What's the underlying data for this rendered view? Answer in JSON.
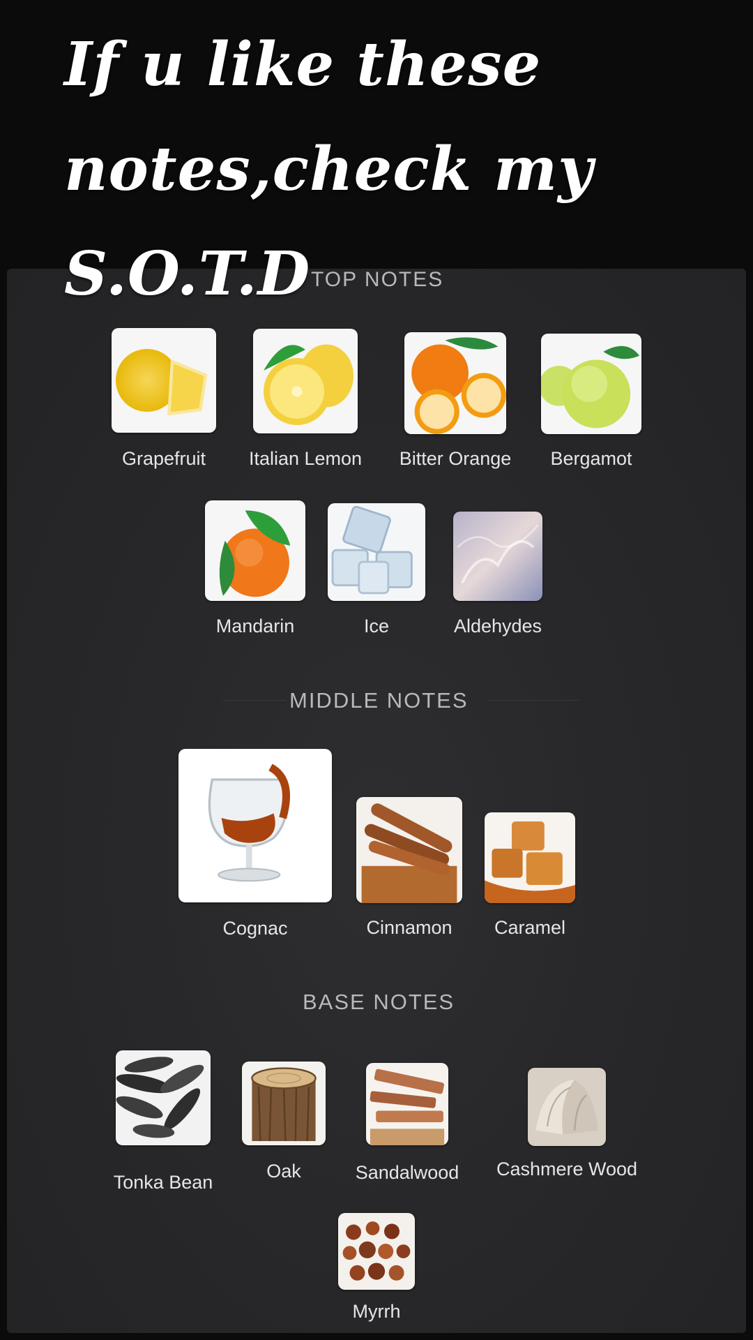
{
  "caption": {
    "line1": "If u like these",
    "line2": "notes,check my",
    "line3": "S.O.T.D"
  },
  "top_notes": {
    "title": "TOP NOTES",
    "items": [
      {
        "label": "Grapefruit",
        "icon": "grapefruit-icon"
      },
      {
        "label": "Italian Lemon",
        "icon": "lemon-icon"
      },
      {
        "label": "Bitter Orange",
        "icon": "bitter-orange-icon"
      },
      {
        "label": "Bergamot",
        "icon": "bergamot-icon"
      },
      {
        "label": "Mandarin",
        "icon": "mandarin-icon"
      },
      {
        "label": "Ice",
        "icon": "ice-icon"
      },
      {
        "label": "Aldehydes",
        "icon": "aldehydes-icon"
      }
    ]
  },
  "middle_notes": {
    "title": "MIDDLE NOTES",
    "items": [
      {
        "label": "Cognac",
        "icon": "cognac-icon"
      },
      {
        "label": "Cinnamon",
        "icon": "cinnamon-icon"
      },
      {
        "label": "Caramel",
        "icon": "caramel-icon"
      }
    ]
  },
  "base_notes": {
    "title": "BASE NOTES",
    "items": [
      {
        "label": "Tonka Bean",
        "icon": "tonka-bean-icon"
      },
      {
        "label": "Oak",
        "icon": "oak-icon"
      },
      {
        "label": "Sandalwood",
        "icon": "sandalwood-icon"
      },
      {
        "label": "Cashmere Wood",
        "icon": "cashmere-wood-icon"
      },
      {
        "label": "Myrrh",
        "icon": "myrrh-icon"
      }
    ]
  },
  "colors": {
    "page_background": "#0b0b0b",
    "card_background": "#2a2a2c",
    "section_title": "#b9b9bd",
    "label": "#e6e6e8",
    "caption": "#ffffff"
  }
}
